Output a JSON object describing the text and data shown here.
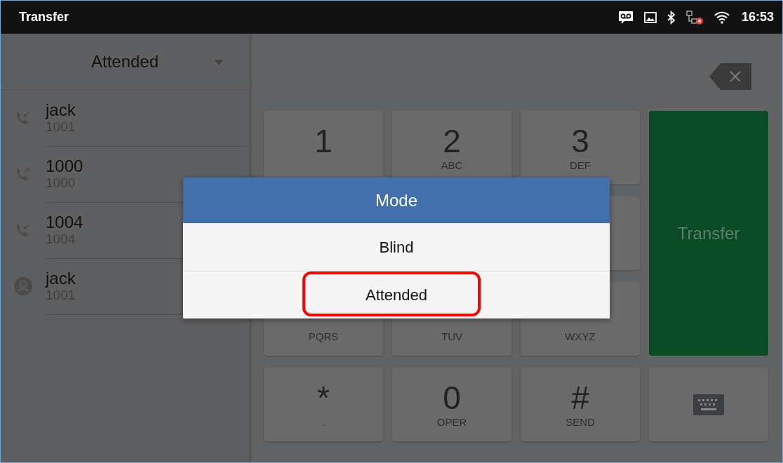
{
  "status_bar": {
    "title": "Transfer",
    "time": "16:53"
  },
  "mode_dropdown": {
    "value": "Attended"
  },
  "calls": [
    {
      "name": "jack",
      "number": "1001",
      "kind": "incoming"
    },
    {
      "name": "1000",
      "number": "1000",
      "kind": "outgoing"
    },
    {
      "name": "1004",
      "number": "1004",
      "kind": "incoming"
    },
    {
      "name": "jack",
      "number": "1001",
      "kind": "contact"
    }
  ],
  "keypad": [
    {
      "digit": "1"
    },
    {
      "digit": "2",
      "letters": "ABC"
    },
    {
      "digit": "3",
      "letters": "DEF"
    },
    {
      "letters": "PQRS"
    },
    {
      "letters": "TUV"
    },
    {
      "letters": "WXYZ"
    },
    {
      "digit": "*",
      "letters": "."
    },
    {
      "digit": "0",
      "letters": "OPER"
    },
    {
      "digit": "#",
      "letters": "SEND"
    }
  ],
  "transfer_button": {
    "label": "Transfer"
  },
  "dialog": {
    "title": "Mode",
    "options": [
      {
        "label": "Blind",
        "annotated": false
      },
      {
        "label": "Attended",
        "annotated": true
      }
    ]
  }
}
